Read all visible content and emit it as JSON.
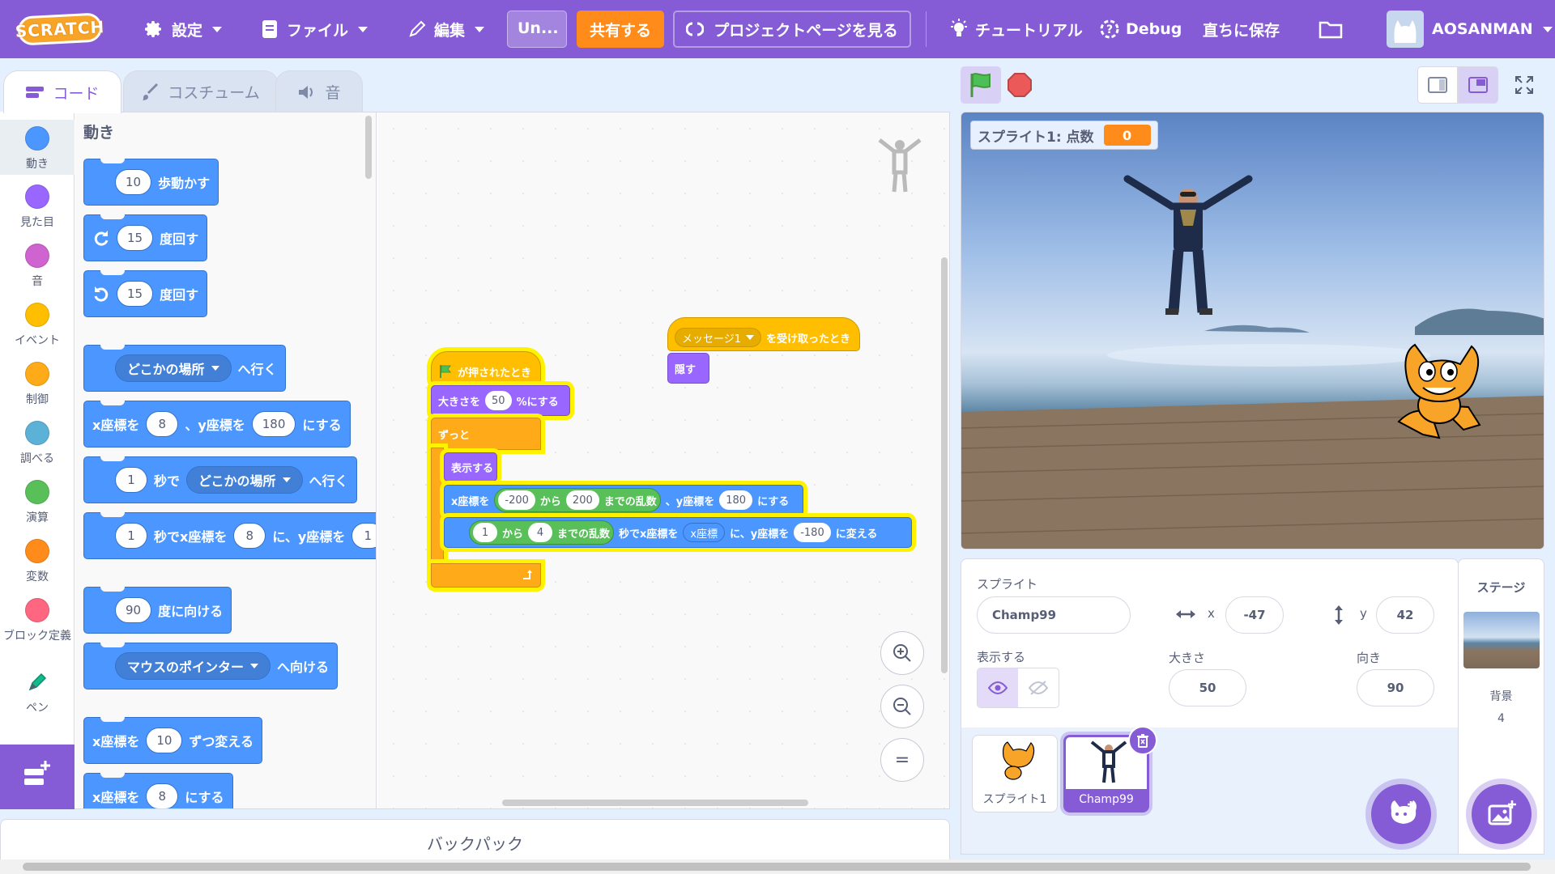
{
  "menu": {
    "logo": "SCRATCH",
    "settings": "設定",
    "file": "ファイル",
    "edit": "編集",
    "project_title": "Un...",
    "share": "共有する",
    "see_project_page": "プロジェクトページを見る",
    "tutorials": "チュートリアル",
    "debug": "Debug",
    "save_now": "直ちに保存",
    "username": "AOSANMAN"
  },
  "tabs": [
    {
      "label": "コード"
    },
    {
      "label": "コスチューム"
    },
    {
      "label": "音"
    }
  ],
  "categories": [
    {
      "label": "動き",
      "color": "#4c97ff"
    },
    {
      "label": "見た目",
      "color": "#9966ff"
    },
    {
      "label": "音",
      "color": "#cf63cf"
    },
    {
      "label": "イベント",
      "color": "#ffbf00"
    },
    {
      "label": "制御",
      "color": "#ffab19"
    },
    {
      "label": "調べる",
      "color": "#5cb1d6"
    },
    {
      "label": "演算",
      "color": "#59c059"
    },
    {
      "label": "変数",
      "color": "#ff8c1a"
    },
    {
      "label": "ブロック定義",
      "color": "#ff6680"
    },
    {
      "label": "ペン",
      "color": "#0fbd8c"
    }
  ],
  "palette": {
    "heading": "動き",
    "move": {
      "value": "10",
      "text": "歩動かす"
    },
    "turn_right": {
      "value": "15",
      "text": "度回す"
    },
    "turn_left": {
      "value": "15",
      "text": "度回す"
    },
    "goto": {
      "dropdown": "どこかの場所",
      "text": "へ行く"
    },
    "goto_xy": {
      "t1": "x座標を",
      "x": "8",
      "t2": "、y座標を",
      "y": "180",
      "t3": "にする"
    },
    "glide": {
      "secs": "1",
      "t1": "秒で",
      "dropdown": "どこかの場所",
      "t2": "へ行く"
    },
    "glide_xy": {
      "secs": "1",
      "t1": "秒でx座標を",
      "x": "8",
      "t2": "に、y座標を",
      "y": "1"
    },
    "point_dir": {
      "value": "90",
      "text": "度に向ける"
    },
    "point_towards": {
      "dropdown": "マウスのポインター",
      "text": "へ向ける"
    },
    "change_x": {
      "t1": "x座標を",
      "value": "10",
      "t2": "ずつ変える"
    },
    "set_x": {
      "t1": "x座標を",
      "value": "8",
      "t2": "にする"
    }
  },
  "script1": {
    "hat": "が押されたとき",
    "size": {
      "t1": "大きさを",
      "value": "50",
      "t2": "%にする"
    },
    "forever": "ずっと",
    "show": "表示する",
    "setxy": {
      "t1": "x座標を",
      "from": "-200",
      "t2": "から",
      "to": "200",
      "t3": "までの乱数",
      "t4": "、y座標を",
      "y": "180",
      "t5": "にする"
    },
    "glide": {
      "from": "1",
      "t1": "から",
      "to": "4",
      "t2": "までの乱数",
      "t3": "秒でx座標を",
      "x": "x座標",
      "t4": "に、y座標を",
      "y": "-180",
      "t5": "に変える"
    }
  },
  "script2": {
    "hat_dropdown": "メッセージ1",
    "hat_text": "を受け取ったとき",
    "hide": "隠す"
  },
  "workspace_zoom": {
    "in": "+",
    "out": "−",
    "reset": "="
  },
  "backpack": "バックパック",
  "stage": {
    "monitor_label": "スプライト1: 点数",
    "monitor_value": "0"
  },
  "sprite_info": {
    "sprite_label": "スプライト",
    "sprite_name": "Champ99",
    "x_label": "x",
    "x": "-47",
    "y_label": "y",
    "y": "42",
    "show_label": "表示する",
    "size_label": "大きさ",
    "size": "50",
    "direction_label": "向き",
    "direction": "90"
  },
  "sprites": [
    {
      "name": "スプライト1",
      "selected": false
    },
    {
      "name": "Champ99",
      "selected": true
    }
  ],
  "stage_panel": {
    "title": "ステージ",
    "backdrops_label": "背景",
    "backdrops_count": "4"
  }
}
